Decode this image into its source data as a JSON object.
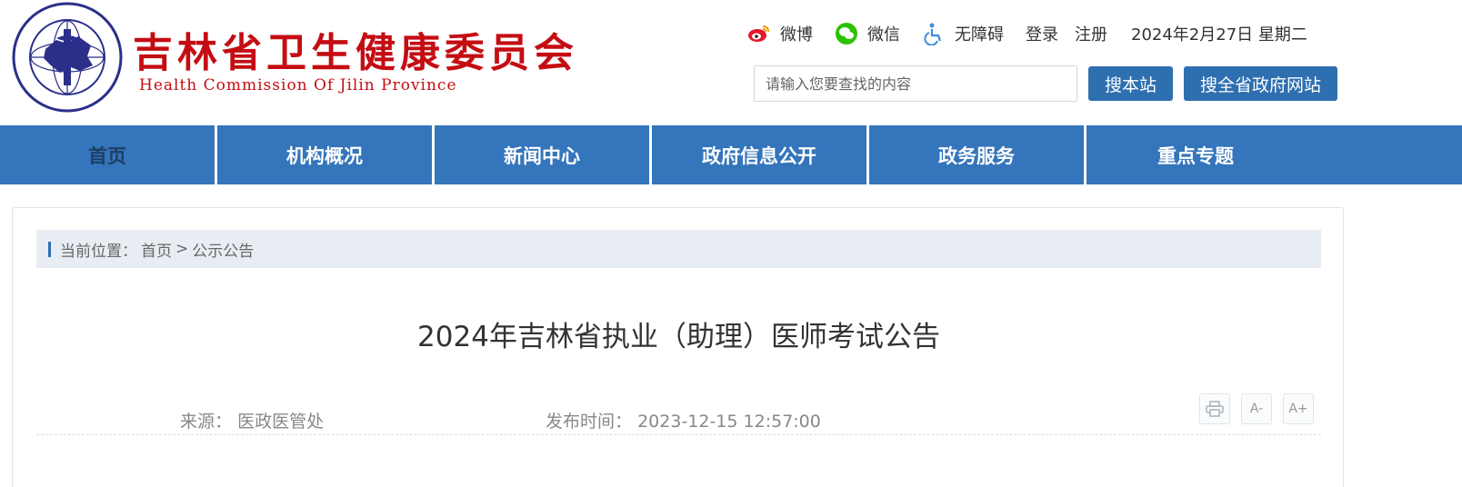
{
  "header": {
    "title_cn": "吉林省卫生健康委员会",
    "title_en": "Health Commission Of Jilin Province",
    "logo_ring_text": "吉林省卫生健康委员会 Health Commission Of Jilin Province",
    "links": [
      {
        "label": "微博",
        "icon": "weibo-icon"
      },
      {
        "label": "微信",
        "icon": "wechat-icon"
      },
      {
        "label": "无障碍",
        "icon": "accessibility-icon"
      }
    ],
    "login": "登录",
    "register": "注册",
    "date": "2024年2月27日 星期二"
  },
  "search": {
    "placeholder": "请输入您要查找的内容",
    "value": "",
    "btn_site": "搜本站",
    "btn_province": "搜全省政府网站"
  },
  "nav": {
    "items": [
      "首页",
      "机构概况",
      "新闻中心",
      "政府信息公开",
      "政务服务",
      "重点专题"
    ],
    "active_index": 0
  },
  "breadcrumb": {
    "label": "当前位置：",
    "home": "首页",
    "sep": ">",
    "current": "公示公告"
  },
  "article": {
    "title": "2024年吉林省执业（助理）医师考试公告",
    "source_label": "来源：",
    "source": "医政医管处",
    "time_label": "发布时间：",
    "time": "2023-12-15 12:57:00"
  },
  "tools": {
    "print_icon": "printer-icon",
    "font_smaller": "A-",
    "font_larger": "A+"
  },
  "colors": {
    "brand_red": "#c40d13",
    "nav_blue": "#3475bb",
    "button_blue": "#2e6fb0"
  }
}
